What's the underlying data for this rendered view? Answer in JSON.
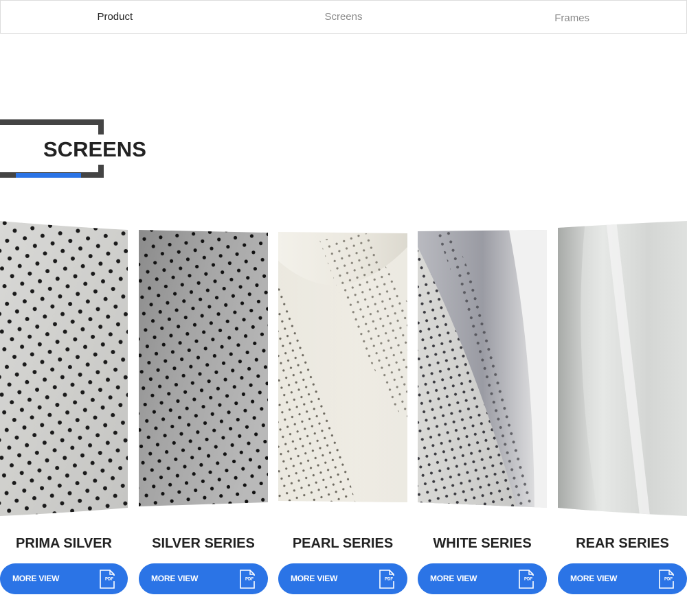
{
  "nav": {
    "tabs": [
      {
        "label": "Product"
      },
      {
        "label": "Screens"
      },
      {
        "label": "Frames"
      }
    ]
  },
  "section": {
    "title": "SCREENS"
  },
  "colors": {
    "accent": "#2b74e6",
    "frame": "#444444"
  },
  "products": [
    {
      "name": "PRIMA SILVER",
      "button": "MORE VIEW",
      "icon": "pdf-icon"
    },
    {
      "name": "SILVER SERIES",
      "button": "MORE VIEW",
      "icon": "pdf-icon"
    },
    {
      "name": "PEARL SERIES",
      "button": "MORE VIEW",
      "icon": "pdf-icon"
    },
    {
      "name": "WHITE SERIES",
      "button": "MORE VIEW",
      "icon": "pdf-icon"
    },
    {
      "name": "REAR SERIES",
      "button": "MORE VIEW",
      "icon": "pdf-icon"
    }
  ],
  "pdf_icon_text": "PDF"
}
